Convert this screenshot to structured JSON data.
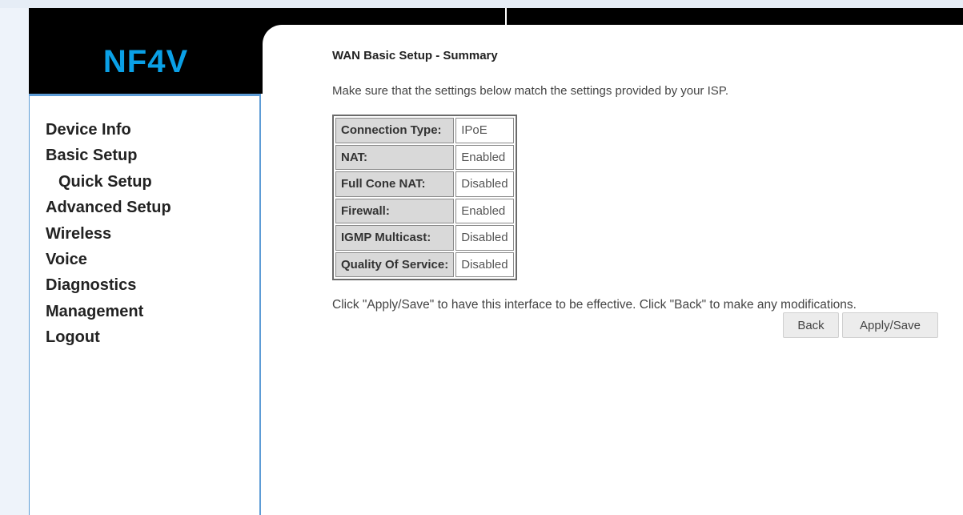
{
  "brand": {
    "logo_text": "NF4V",
    "logo_color": "#0aa0e6"
  },
  "sidebar": {
    "items": [
      {
        "label": "Device Info"
      },
      {
        "label": "Basic Setup"
      },
      {
        "label": "Quick Setup"
      },
      {
        "label": "Advanced Setup"
      },
      {
        "label": "Wireless"
      },
      {
        "label": "Voice"
      },
      {
        "label": "Diagnostics"
      },
      {
        "label": "Management"
      },
      {
        "label": "Logout"
      }
    ]
  },
  "main": {
    "title": "WAN Basic Setup - Summary",
    "intro": "Make sure that the settings below match the settings provided by your ISP.",
    "summary": [
      {
        "label": "Connection Type:",
        "value": "IPoE"
      },
      {
        "label": "NAT:",
        "value": "Enabled"
      },
      {
        "label": "Full Cone NAT:",
        "value": "Disabled"
      },
      {
        "label": "Firewall:",
        "value": "Enabled"
      },
      {
        "label": "IGMP Multicast:",
        "value": "Disabled"
      },
      {
        "label": "Quality Of Service:",
        "value": "Disabled"
      }
    ],
    "note": "Click \"Apply/Save\" to have this interface to be effective. Click \"Back\" to make any modifications.",
    "buttons": {
      "back": "Back",
      "apply_save": "Apply/Save"
    }
  },
  "colors": {
    "header_background": "#000000",
    "sidebar_border": "#5d9cd6",
    "table_label_background": "#d9d9d9"
  }
}
